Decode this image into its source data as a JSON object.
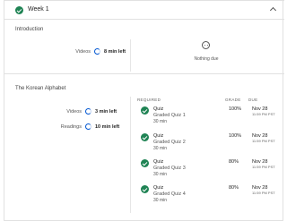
{
  "week": {
    "title": "Week 1"
  },
  "introduction": {
    "title": "Introduction",
    "videos_label": "Videos",
    "videos_value": "8 min left",
    "nothing_due": "Nothing due"
  },
  "lesson": {
    "title": "The Korean Alphabet",
    "videos_label": "Videos",
    "videos_value": "3 min left",
    "readings_label": "Readings",
    "readings_value": "10 min left"
  },
  "columns": {
    "required": "REQUIRED",
    "grade": "GRADE",
    "due": "DUE"
  },
  "items": [
    {
      "type": "Quiz",
      "name": "Graded Quiz 1",
      "duration": "30 min",
      "grade": "100%",
      "date": "Nov 28",
      "time": "11:59 PM PST"
    },
    {
      "type": "Quiz",
      "name": "Graded Quiz 2",
      "duration": "30 min",
      "grade": "100%",
      "date": "Nov 28",
      "time": "11:59 PM PST"
    },
    {
      "type": "Quiz",
      "name": "Graded Quiz 3",
      "duration": "30 min",
      "grade": "80%",
      "date": "Nov 28",
      "time": "11:59 PM PST"
    },
    {
      "type": "Quiz",
      "name": "Graded Quiz 4",
      "duration": "30 min",
      "grade": "80%",
      "date": "Nov 28",
      "time": "11:59 PM PST"
    }
  ],
  "colors": {
    "complete": "#1f8354",
    "progress": "#0056d2"
  }
}
